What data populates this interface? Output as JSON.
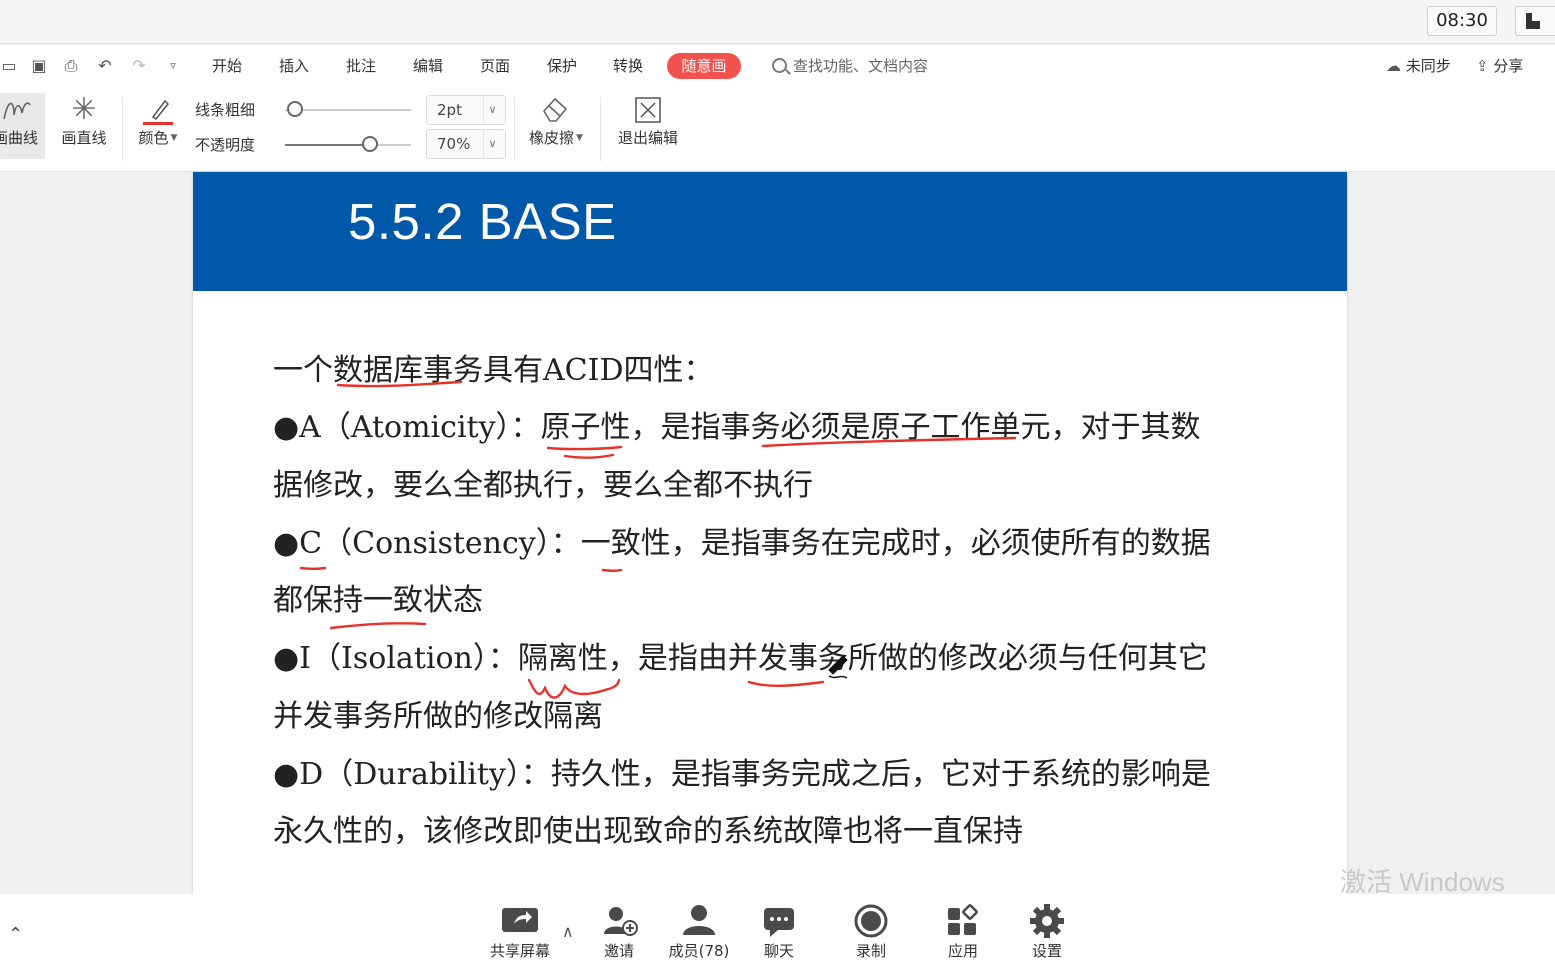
{
  "clock": "08:30",
  "menu": {
    "items": [
      "开始",
      "插入",
      "批注",
      "编辑",
      "页面",
      "保护",
      "转换"
    ],
    "free_draw": "随意画",
    "search_placeholder": "查找功能、文档内容",
    "sync": "未同步",
    "share": "分享"
  },
  "ribbon": {
    "curve": "画曲线",
    "line": "画直线",
    "color": "颜色",
    "thickness_label": "线条粗细",
    "thickness_value": "2pt",
    "opacity_label": "不透明度",
    "opacity_value": "70%",
    "eraser": "橡皮擦",
    "exit": "退出编辑"
  },
  "slide": {
    "title": "5.5.2  BASE",
    "lines": [
      "一个数据库事务具有ACID四性：",
      "●A（Atomicity）：原子性，是指事务必须是原子工作单元，对于其数",
      "据修改，要么全都执行，要么全都不执行",
      "●C（Consistency）：一致性，是指事务在完成时，必须使所有的数据",
      "都保持一致状态",
      "●I（Isolation）：隔离性，是指由并发事务所做的修改必须与任何其它",
      "并发事务所做的修改隔离",
      "●D（Durability）：持久性，是指事务完成之后，它对于系统的影响是",
      "永久性的，该修改即使出现致命的系统故障也将一直保持"
    ],
    "annotation_color": "#e8312b"
  },
  "watermark": "激活 Windows",
  "meeting": {
    "share_screen": "共享屏幕",
    "invite": "邀请",
    "members": "成员(78)",
    "chat": "聊天",
    "record": "录制",
    "apps": "应用",
    "settings": "设置"
  }
}
